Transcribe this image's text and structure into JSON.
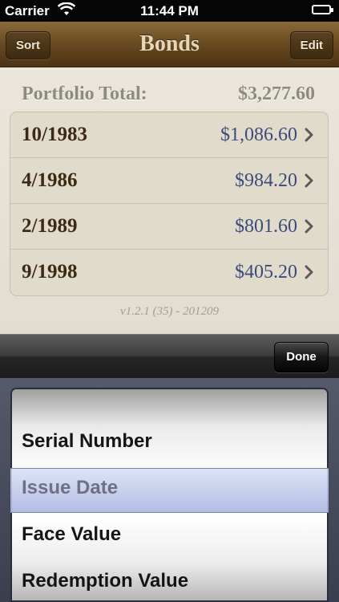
{
  "status_bar": {
    "carrier": "Carrier",
    "time": "11:44 PM"
  },
  "nav": {
    "title": "Bonds",
    "left_button": "Sort",
    "right_button": "Edit"
  },
  "portfolio": {
    "label": "Portfolio Total:",
    "value": "$3,277.60"
  },
  "bonds": [
    {
      "date": "10/1983",
      "amount": "$1,086.60"
    },
    {
      "date": "4/1986",
      "amount": "$984.20"
    },
    {
      "date": "2/1989",
      "amount": "$801.60"
    },
    {
      "date": "9/1998",
      "amount": "$405.20"
    }
  ],
  "version": "v1.2.1 (35) - 201209",
  "toolbar": {
    "done_label": "Done"
  },
  "picker": {
    "options": [
      "Serial Number",
      "Issue Date",
      "Face Value",
      "Redemption Value"
    ],
    "selected": "Issue Date"
  },
  "colors": {
    "nav_brown": "#6a4c22",
    "amount_blue": "#3d4b7a",
    "date_brown": "#3c2a14"
  }
}
